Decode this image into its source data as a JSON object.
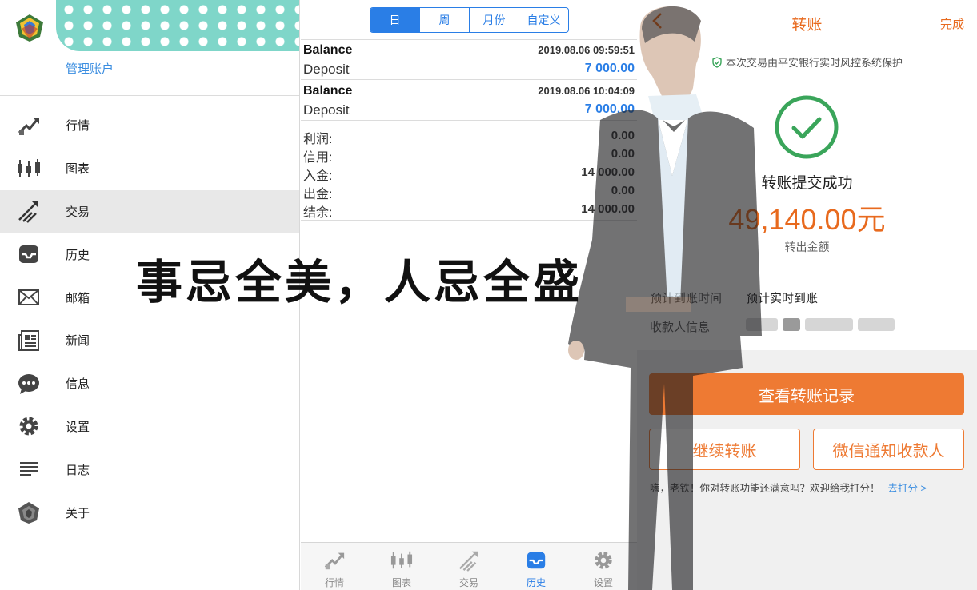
{
  "menu_panel": {
    "manage_label": "管理账户",
    "items": [
      {
        "label": "行情",
        "icon": "quotes-icon",
        "active": false
      },
      {
        "label": "图表",
        "icon": "candlestick-chart-icon",
        "active": false
      },
      {
        "label": "交易",
        "icon": "trade-icon",
        "active": true
      },
      {
        "label": "历史",
        "icon": "history-inbox-icon",
        "active": false
      },
      {
        "label": "邮箱",
        "icon": "mail-icon",
        "active": false
      },
      {
        "label": "新闻",
        "icon": "news-icon",
        "active": false
      },
      {
        "label": "信息",
        "icon": "chat-bubble-icon",
        "active": false
      },
      {
        "label": "设置",
        "icon": "gear-icon",
        "active": false
      },
      {
        "label": "日志",
        "icon": "journal-lines-icon",
        "active": false
      },
      {
        "label": "关于",
        "icon": "about-logo-icon",
        "active": false
      }
    ]
  },
  "history_panel": {
    "segments": [
      "日",
      "周",
      "月份",
      "自定义"
    ],
    "selected_segment": "日",
    "deals": [
      {
        "type": "Balance",
        "datetime": "2019.08.06 09:59:51",
        "subtype": "Deposit",
        "amount": "7 000.00"
      },
      {
        "type": "Balance",
        "datetime": "2019.08.06 10:04:09",
        "subtype": "Deposit",
        "amount": "7 000.00"
      }
    ],
    "summary": [
      {
        "label": "利润:",
        "value": "0.00"
      },
      {
        "label": "信用:",
        "value": "0.00"
      },
      {
        "label": "入金:",
        "value": "14 000.00"
      },
      {
        "label": "出金:",
        "value": "0.00"
      },
      {
        "label": "结余:",
        "value": "14 000.00"
      }
    ],
    "tabs": [
      {
        "label": "行情",
        "icon": "quotes-icon"
      },
      {
        "label": "图表",
        "icon": "candlestick-chart-icon"
      },
      {
        "label": "交易",
        "icon": "trade-icon"
      },
      {
        "label": "历史",
        "icon": "history-inbox-icon"
      },
      {
        "label": "设置",
        "icon": "gear-icon"
      }
    ],
    "active_tab": "历史",
    "accent_color": "#2a7ee6"
  },
  "transfer_panel": {
    "title": "转账",
    "done_label": "完成",
    "security_note": "本次交易由平安银行实时风控系统保护",
    "success_text": "转账提交成功",
    "amount": "49,140.00元",
    "amount_label": "转出金额",
    "arrival_label": "预计到账时间",
    "arrival_value": "预计实时到账",
    "payee_label": "收款人信息",
    "primary_button": "查看转账记录",
    "secondary_buttons": [
      "继续转账",
      "微信通知收款人"
    ],
    "feedback_text": "嗨，老铁！你对转账功能还满意吗？欢迎给我打分！",
    "feedback_link": "去打分 >",
    "accent_color": "#ee7a33"
  },
  "slogan": "事忌全美，人忌全盛"
}
